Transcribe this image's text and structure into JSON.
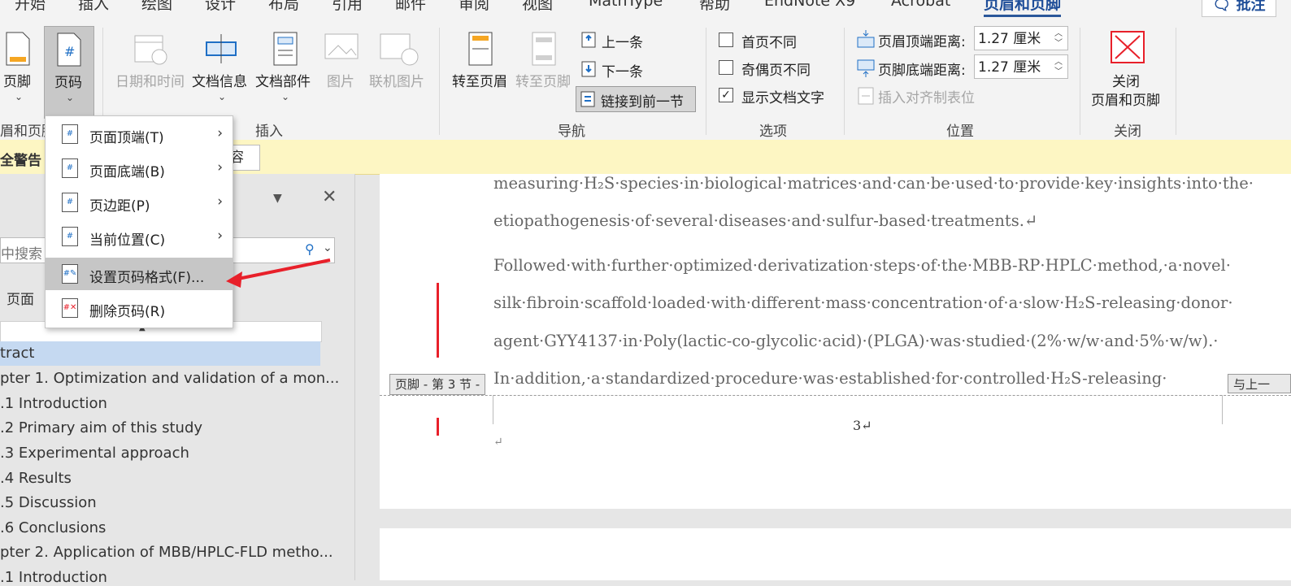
{
  "tabs": [
    "开始",
    "插入",
    "绘图",
    "设计",
    "布局",
    "引用",
    "邮件",
    "审阅",
    "视图",
    "MathType",
    "帮助",
    "EndNote X9",
    "Acrobat",
    "页眉和页脚"
  ],
  "active_tab": "页眉和页脚",
  "comment_label": "批注",
  "ribbon": {
    "footer_label": "页脚",
    "page_number_label": "页码",
    "group_header_footer": "眉和页脚",
    "date_time_label": "日期和时间",
    "doc_info_label": "文档信息",
    "doc_parts_label": "文档部件",
    "picture_label": "图片",
    "online_picture_label": "联机图片",
    "group_insert": "插入",
    "goto_header_label": "转至页眉",
    "goto_footer_label": "转至页脚",
    "previous_label": "上一条",
    "next_label": "下一条",
    "link_previous_label": "链接到前一节",
    "group_navigation": "导航",
    "different_first_page": "首页不同",
    "different_odd_even": "奇偶页不同",
    "show_document_text": "显示文档文字",
    "show_document_text_checked": true,
    "group_options": "选项",
    "header_from_top_label": "页眉顶端距离:",
    "header_from_top_value": "1.27 厘米",
    "footer_from_bottom_label": "页脚底端距离:",
    "footer_from_bottom_value": "1.27 厘米",
    "insert_alignment_tab": "插入对齐制表位",
    "group_position": "位置",
    "close_label_1": "关闭",
    "close_label_2": "页眉和页脚",
    "group_close": "关闭"
  },
  "warning": {
    "title": "全警告",
    "button_fragment": "容"
  },
  "nav": {
    "search_placeholder": "中搜索",
    "tab_pages": "页面",
    "items": [
      "tract",
      "pter 1. Optimization and validation of a mon...",
      ".1 Introduction",
      ".2 Primary aim of this study",
      ".3 Experimental approach",
      ".4 Results",
      ".5 Discussion",
      ".6 Conclusions",
      "pter 2. Application of MBB/HPLC-FLD metho...",
      ".1 Introduction"
    ],
    "selected_index": 0
  },
  "menu": {
    "items": [
      {
        "label": "页面顶端(T)",
        "has_submenu": true
      },
      {
        "label": "页面底端(B)",
        "has_submenu": true
      },
      {
        "label": "页边距(P)",
        "has_submenu": true
      },
      {
        "label": "当前位置(C)",
        "has_submenu": true
      },
      {
        "label": "设置页码格式(F)...",
        "has_submenu": false,
        "highlighted": true
      },
      {
        "label": "删除页码(R)",
        "has_submenu": false
      }
    ]
  },
  "document": {
    "lines": [
      "measuring·H₂S·species·in·biological·matrices·and·can·be·used·to·provide·key·insights·into·the·",
      "etiopathogenesis·of·several·diseases·and·sulfur-based·treatments.↵",
      "Followed·with·further·optimized·derivatization·steps·of·the·MBB-RP·HPLC·method,·a·novel·",
      "silk·fibroin·scaffold·loaded·with·different·mass·concentration·of·a·slow·H₂S-releasing·donor·",
      "agent·GYY4137·in·Poly(lactic-co-glycolic·acid)·(PLGA)·was·studied·(2%·w/w·and·5%·w/w).·",
      "In·addition,·a·standardized·procedure·was·established·for·controlled·H₂S-releasing·"
    ],
    "footer_tag": "页脚 - 第 3 节 -",
    "same_as_previous_tag": "与上一",
    "page_number": "3↵",
    "para_mark": "↵"
  },
  "colors": {
    "accent": "#2b579a",
    "arrow": "#e8202a",
    "warning_bg": "#fdf6c3"
  }
}
